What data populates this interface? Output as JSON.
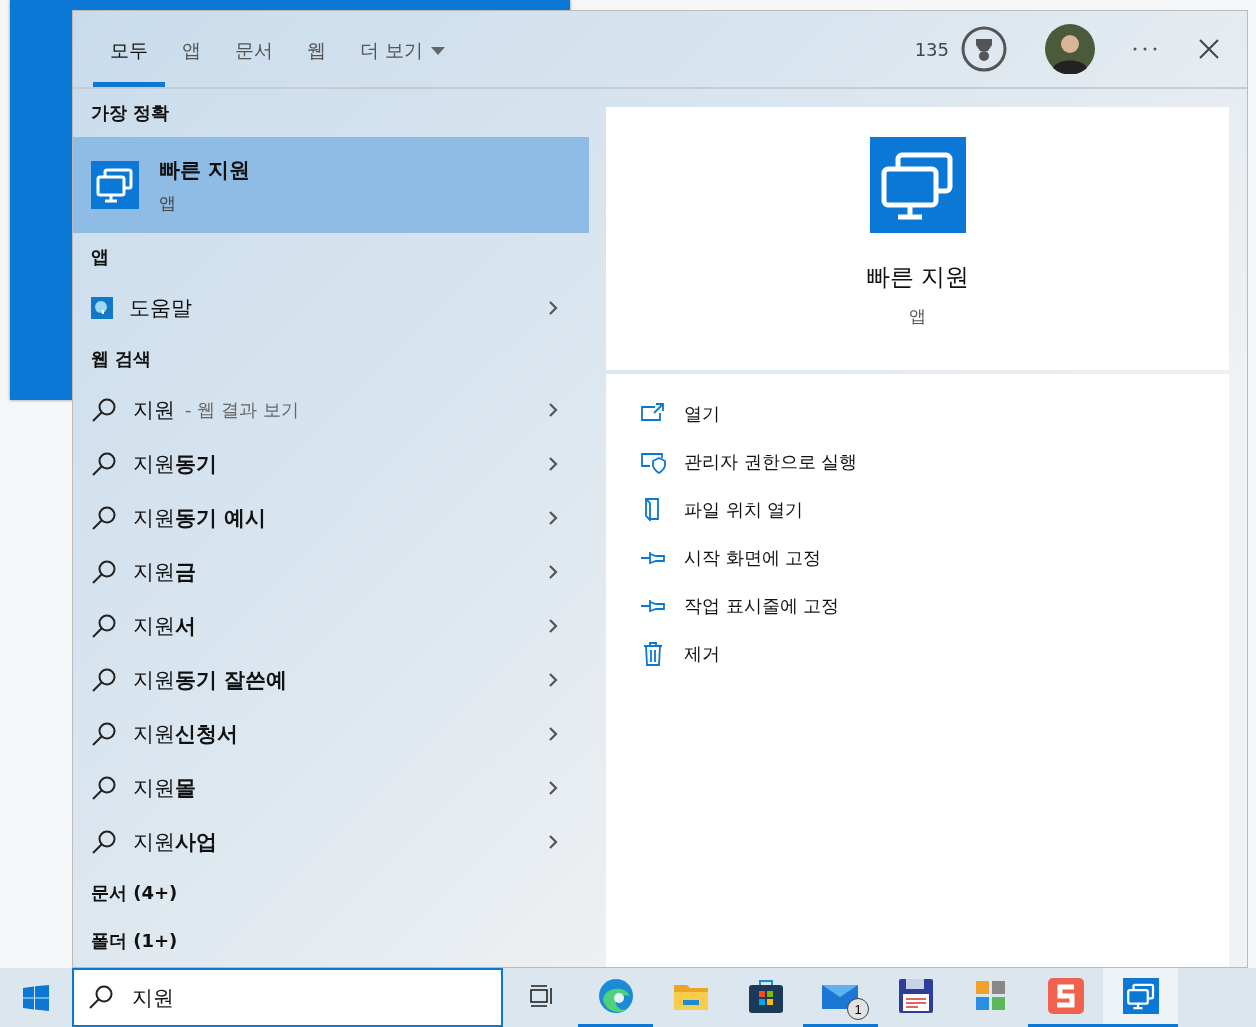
{
  "tabs": [
    {
      "label": "모두",
      "selected": true,
      "kind": "plain"
    },
    {
      "label": "앱",
      "selected": false,
      "kind": "plain"
    },
    {
      "label": "문서",
      "selected": false,
      "kind": "plain"
    },
    {
      "label": "웹",
      "selected": false,
      "kind": "plain"
    },
    {
      "label": "더 보기",
      "selected": false,
      "kind": "dropdown"
    }
  ],
  "header": {
    "points": "135"
  },
  "sections": [
    {
      "title": "가장 정확",
      "items": [
        {
          "kind": "best",
          "title": "빠른 지원",
          "subtitle": "앱",
          "selected": true
        }
      ]
    },
    {
      "title": "앱",
      "items": [
        {
          "kind": "app",
          "title": "도움말",
          "selected": false
        }
      ]
    },
    {
      "title": "웹 검색",
      "items": [
        {
          "kind": "web",
          "title": "지원",
          "hint": "- 웹 결과 보기",
          "selected": false
        },
        {
          "kind": "web",
          "title": "지원**동기**",
          "selected": false
        },
        {
          "kind": "web",
          "title": "지원**동기 예시**",
          "selected": false
        },
        {
          "kind": "web",
          "title": "지원**금**",
          "selected": false
        },
        {
          "kind": "web",
          "title": "지원**서**",
          "selected": false
        },
        {
          "kind": "web",
          "title": "지원**동기 잘쓴예**",
          "selected": false
        },
        {
          "kind": "web",
          "title": "지원**신청서**",
          "selected": false
        },
        {
          "kind": "web",
          "title": "지원**몰**",
          "selected": false
        },
        {
          "kind": "web",
          "title": "지원**사업**",
          "selected": false
        }
      ]
    },
    {
      "title": "문서 (4+)"
    },
    {
      "title": "폴더 (1+)"
    }
  ],
  "preview": {
    "title": "빠른 지원",
    "subtitle": "앱",
    "actions": [
      {
        "kind": "open",
        "label": "열기"
      },
      {
        "kind": "admin",
        "label": "관리자 권한으로 실행"
      },
      {
        "kind": "folder",
        "label": "파일 위치 열기"
      },
      {
        "kind": "pin",
        "label": "시작 화면에 고정"
      },
      {
        "kind": "pin",
        "label": "작업 표시줄에 고정"
      },
      {
        "kind": "trash",
        "label": "제거"
      }
    ]
  },
  "taskbar": {
    "search_value": "지원",
    "apps": [
      {
        "kind": "taskview",
        "running": false,
        "selected": false
      },
      {
        "kind": "browser",
        "running": true,
        "selected": false
      },
      {
        "kind": "folder",
        "running": false,
        "selected": false
      },
      {
        "kind": "store",
        "running": false,
        "selected": false
      },
      {
        "kind": "mail",
        "running": true,
        "selected": false,
        "badge": "1"
      },
      {
        "kind": "floppy",
        "running": false,
        "selected": false
      },
      {
        "kind": "grid",
        "running": false,
        "selected": false
      },
      {
        "kind": "sapp",
        "running": true,
        "selected": false
      },
      {
        "kind": "remote",
        "running": true,
        "selected": true
      }
    ]
  }
}
